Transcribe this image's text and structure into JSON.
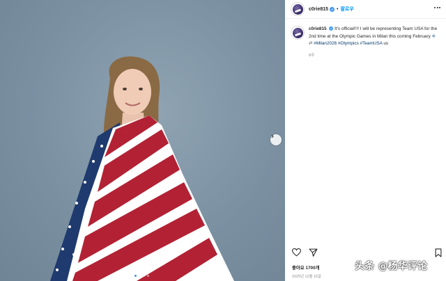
{
  "post": {
    "username": "c0rie815",
    "follow_label": "팔로우",
    "caption_user": "c0rie815",
    "caption_lines": [
      "It's official!!!! I will be representing",
      "Team USA for the 2nd time at the Olympic Games",
      "in Milan this coming February"
    ],
    "hashtags_line1": "#Milan2026",
    "hashtags_line2_a": "#Olympics",
    "hashtags_line2_b": "#TeamUSA",
    "hashtags_line2_c": "us",
    "time_ago": "8주",
    "likes": "좋아요 1700개",
    "date": "2025년 12월 16일"
  },
  "carousel": {
    "count": 4,
    "active_index": 0
  },
  "watermark": "头条 @杨华评论",
  "colors": {
    "link_blue": "#0095f6",
    "hashtag_blue": "#00376b",
    "verified_blue": "#3b97f2",
    "photo_bg": "#7b91a2"
  },
  "icons": [
    "more-icon",
    "verified-icon",
    "heart-icon",
    "share-icon",
    "bookmark-icon",
    "chevron-right-icon"
  ]
}
